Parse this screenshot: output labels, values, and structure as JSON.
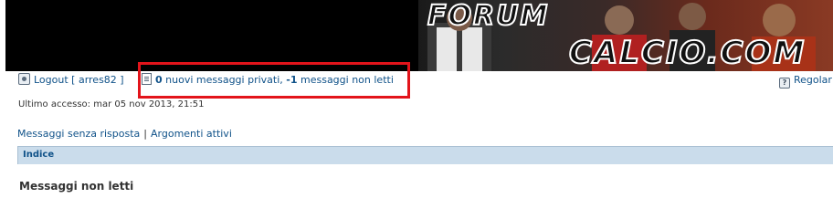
{
  "banner": {
    "logo_line1": "FORUM",
    "logo_line2": "CALCIO.COM"
  },
  "header": {
    "logout_label": "Logout [ arres82 ]",
    "pm_count": "0",
    "pm_text": " nuovi messaggi privati, ",
    "unread_count": "-1",
    "unread_text": " messaggi non letti",
    "register_label": "Regolar"
  },
  "last_visit": "Ultimo accesso: mar 05 nov 2013, 21:51",
  "links": {
    "unanswered": "Messaggi senza risposta",
    "separator": "|",
    "active": "Argomenti attivi"
  },
  "breadcrumb": {
    "index": "Indice"
  },
  "page_title": "Messaggi non letti",
  "colors": {
    "link": "#105289",
    "highlight": "#e3141b",
    "navbar": "#cadceb"
  }
}
